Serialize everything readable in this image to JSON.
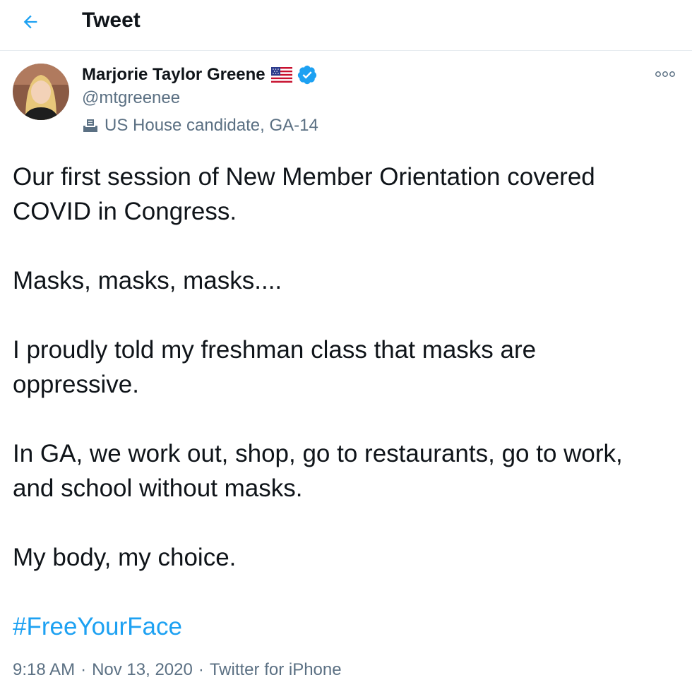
{
  "header": {
    "title": "Tweet"
  },
  "tweet": {
    "author_name": "Marjorie Taylor Greene",
    "handle": "@mtgreenee",
    "bio_label": "US House candidate, GA-14",
    "text_lines": [
      "Our first session of New Member Orientation covered",
      "COVID in Congress.",
      "Masks, masks, masks....",
      "I proudly told my freshman class that masks are",
      "oppressive.",
      "In GA, we work out, shop, go to restaurants, go to work,",
      "and school without masks.",
      "My body, my choice."
    ],
    "hashtag": "#FreeYourFace",
    "time": "9:18 AM",
    "date": "Nov 13, 2020",
    "separator": "·",
    "source": "Twitter for iPhone"
  },
  "icons": {
    "back": "arrow-left-icon",
    "flag": "us-flag-icon",
    "verified": "verified-badge-icon",
    "ballot": "ballot-box-icon",
    "more": "more-options-icon"
  },
  "colors": {
    "accent": "#1da1f2",
    "text": "#0f1419",
    "secondary_text": "#5b7083",
    "divider": "#e6ecf0"
  }
}
